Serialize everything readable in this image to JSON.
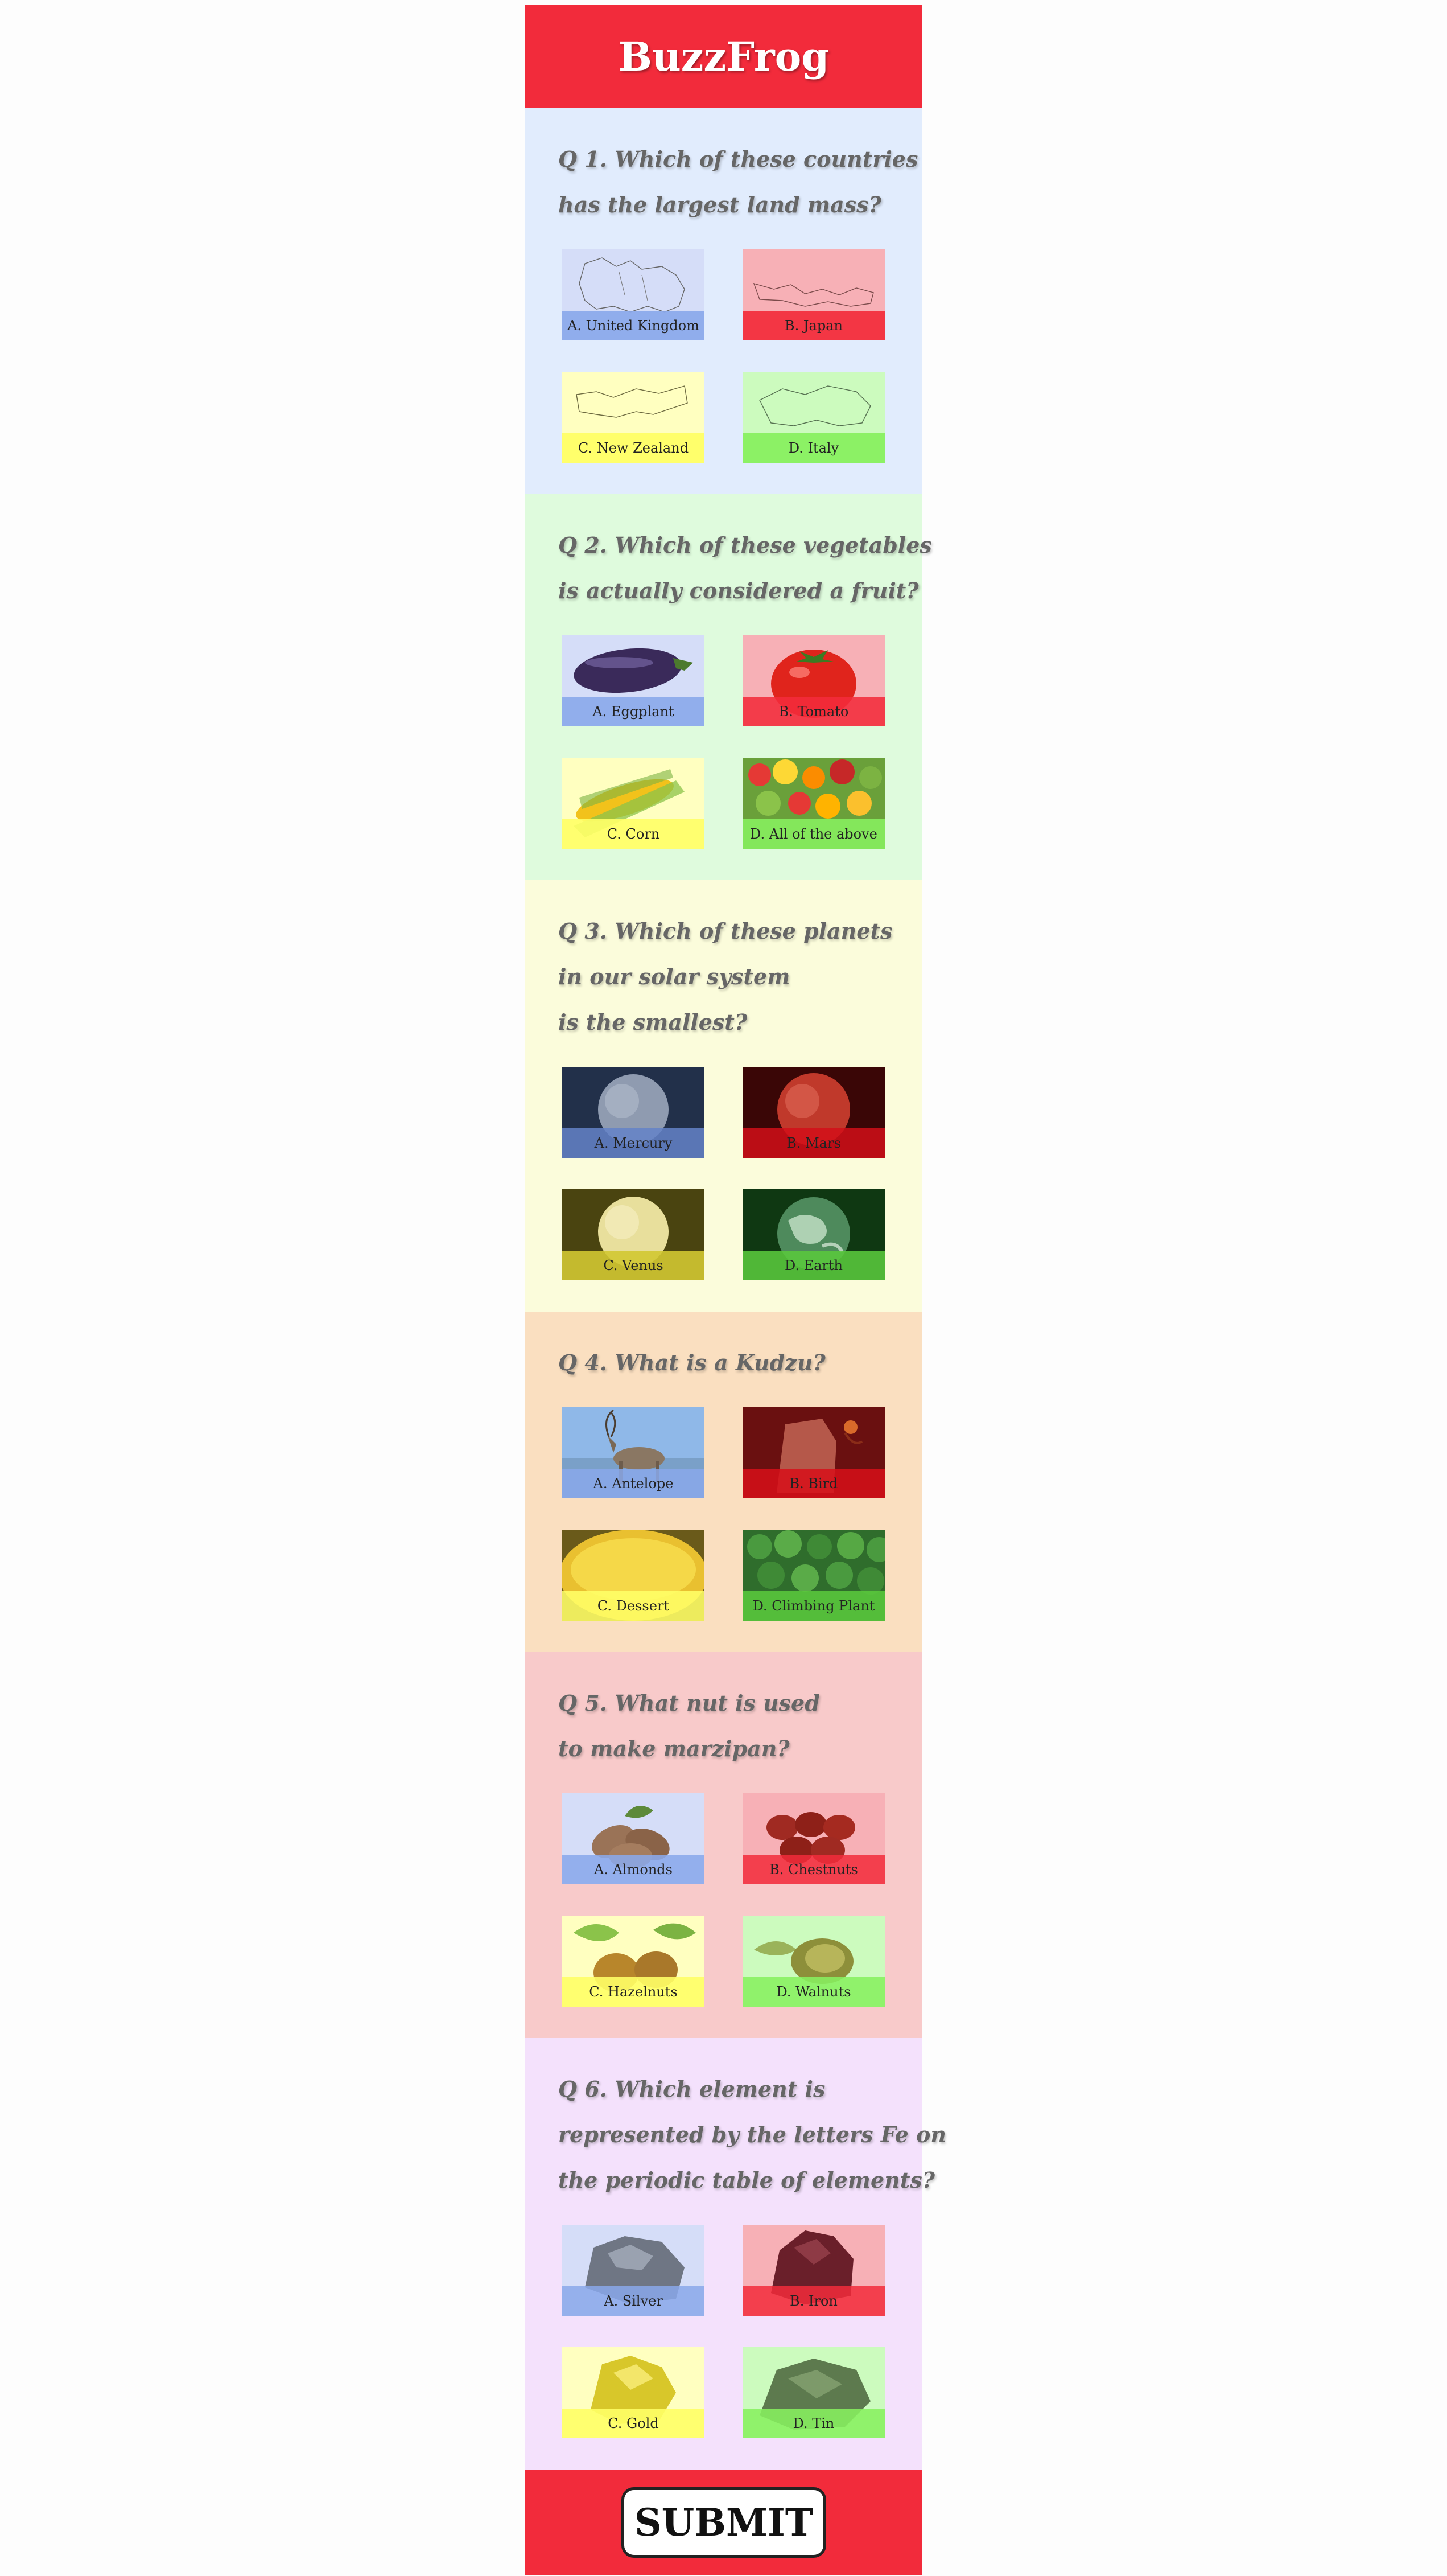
{
  "app": {
    "title": "BuzzFrog",
    "submit_label": "SUBMIT"
  },
  "colors": {
    "brand": "#f22b3b",
    "answer_a": "#8aa8ea",
    "answer_b": "#f22b3b",
    "answer_c": "#ffff66",
    "answer_d": "#88f060"
  },
  "questions": [
    {
      "lines": [
        "Q 1. Which of these countries",
        "has the largest land mass?"
      ],
      "background": "#e1ecfd",
      "answers": [
        {
          "label": "A. United Kingdom",
          "icon": "map-outline-icon"
        },
        {
          "label": "B. Japan",
          "icon": "map-outline-icon"
        },
        {
          "label": "C. New Zealand",
          "icon": "map-outline-icon"
        },
        {
          "label": "D. Italy",
          "icon": "map-outline-icon"
        }
      ]
    },
    {
      "lines": [
        "Q 2. Which of these vegetables",
        "is actually considered a fruit?"
      ],
      "background": "#dffbdd",
      "answers": [
        {
          "label": "A. Eggplant",
          "icon": "eggplant-icon"
        },
        {
          "label": "B. Tomato",
          "icon": "tomato-icon"
        },
        {
          "label": "C. Corn",
          "icon": "corn-icon"
        },
        {
          "label": "D. All of the above",
          "icon": "fruit-pile-icon"
        }
      ]
    },
    {
      "lines": [
        "Q 3. Which of these planets",
        "in our solar system",
        "is the smallest?"
      ],
      "background": "#fbfcdb",
      "answers": [
        {
          "label": "A. Mercury",
          "icon": "mercury-planet-icon"
        },
        {
          "label": "B. Mars",
          "icon": "mars-planet-icon"
        },
        {
          "label": "C. Venus",
          "icon": "venus-planet-icon"
        },
        {
          "label": "D. Earth",
          "icon": "earth-planet-icon"
        }
      ]
    },
    {
      "lines": [
        "Q 4. What is a Kudzu?"
      ],
      "background": "#fadfc0",
      "answers": [
        {
          "label": "A. Antelope",
          "icon": "antelope-icon"
        },
        {
          "label": "B. Bird",
          "icon": "bird-icon"
        },
        {
          "label": "C. Dessert",
          "icon": "dessert-icon"
        },
        {
          "label": "D. Climbing Plant",
          "icon": "leaves-icon"
        }
      ]
    },
    {
      "lines": [
        "Q 5. What nut is used",
        "to make marzipan?"
      ],
      "background": "#f8caca",
      "answers": [
        {
          "label": "A. Almonds",
          "icon": "almonds-icon"
        },
        {
          "label": "B. Chestnuts",
          "icon": "chestnuts-icon"
        },
        {
          "label": "C. Hazelnuts",
          "icon": "hazelnuts-icon"
        },
        {
          "label": "D. Walnuts",
          "icon": "walnuts-icon"
        }
      ]
    },
    {
      "lines": [
        "Q 6. Which element is",
        "represented by the letters Fe on",
        "the periodic table of elements?"
      ],
      "background": "#f4e1fc",
      "answers": [
        {
          "label": "A. Silver",
          "icon": "silver-ore-icon"
        },
        {
          "label": "B. Iron",
          "icon": "iron-ore-icon"
        },
        {
          "label": "C. Gold",
          "icon": "gold-nugget-icon"
        },
        {
          "label": "D. Tin",
          "icon": "tin-ore-icon"
        }
      ]
    }
  ]
}
